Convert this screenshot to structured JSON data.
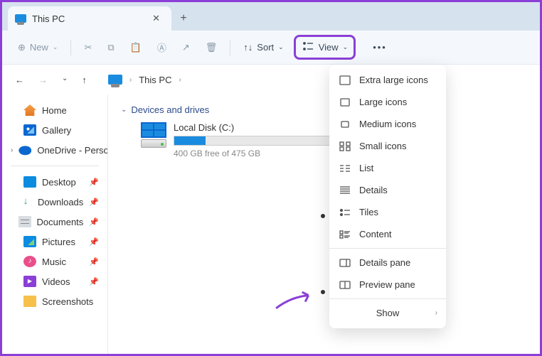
{
  "tab": {
    "title": "This PC"
  },
  "toolbar": {
    "new_label": "New",
    "sort_label": "Sort",
    "view_label": "View"
  },
  "breadcrumb": {
    "location": "This PC"
  },
  "sidebar": {
    "home": "Home",
    "gallery": "Gallery",
    "onedrive": "OneDrive - Perso",
    "desktop": "Desktop",
    "downloads": "Downloads",
    "documents": "Documents",
    "pictures": "Pictures",
    "music": "Music",
    "videos": "Videos",
    "screenshots": "Screenshots"
  },
  "content": {
    "group_title": "Devices and drives",
    "drive": {
      "name": "Local Disk (C:)",
      "free_text": "400 GB free of 475 GB"
    }
  },
  "view_menu": {
    "extra_large": "Extra large icons",
    "large": "Large icons",
    "medium": "Medium icons",
    "small": "Small icons",
    "list": "List",
    "details": "Details",
    "tiles": "Tiles",
    "content": "Content",
    "details_pane": "Details pane",
    "preview_pane": "Preview pane",
    "show": "Show"
  }
}
